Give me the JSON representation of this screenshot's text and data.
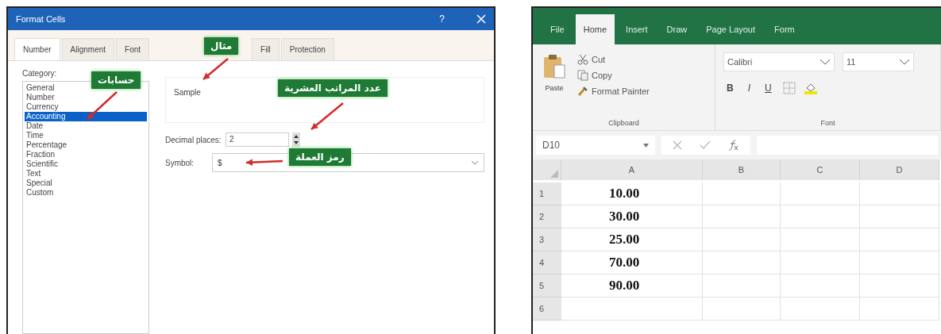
{
  "dialog": {
    "title": "Format Cells",
    "help": "?",
    "tabs": [
      {
        "label": "Number",
        "selected": true
      },
      {
        "label": "Alignment",
        "selected": false
      },
      {
        "label": "Font",
        "selected": false
      },
      {
        "label": "Fill",
        "selected": false
      },
      {
        "label": "Protection",
        "selected": false
      }
    ],
    "category_label": "Category:",
    "categories": [
      {
        "label": "General",
        "selected": false
      },
      {
        "label": "Number",
        "selected": false
      },
      {
        "label": "Currency",
        "selected": false
      },
      {
        "label": "Accounting",
        "selected": true
      },
      {
        "label": "Date",
        "selected": false
      },
      {
        "label": "Time",
        "selected": false
      },
      {
        "label": "Percentage",
        "selected": false
      },
      {
        "label": "Fraction",
        "selected": false
      },
      {
        "label": "Scientific",
        "selected": false
      },
      {
        "label": "Text",
        "selected": false
      },
      {
        "label": "Special",
        "selected": false
      },
      {
        "label": "Custom",
        "selected": false
      }
    ],
    "sample_label": "Sample",
    "decimal_places_label": "Decimal places:",
    "decimal_places_value": "2",
    "symbol_label": "Symbol:",
    "symbol_value": "$"
  },
  "callouts": [
    {
      "text": "مثال"
    },
    {
      "text": "حسابات"
    },
    {
      "text": "عدد المراتب العشرية"
    },
    {
      "text": "رمز العملة"
    }
  ],
  "excel": {
    "tabs": [
      {
        "label": "File",
        "selected": false
      },
      {
        "label": "Home",
        "selected": true
      },
      {
        "label": "Insert",
        "selected": false
      },
      {
        "label": "Draw",
        "selected": false
      },
      {
        "label": "Page Layout",
        "selected": false
      },
      {
        "label": "Form",
        "selected": false
      }
    ],
    "paste": "Paste",
    "cut": "Cut",
    "copy": "Copy",
    "format_painter": "Format Painter",
    "clipboard_label": "Clipboard",
    "font_name": "Calibri",
    "font_size": "11",
    "bold": "B",
    "italic": "I",
    "underline": "U",
    "font_label": "Font",
    "name_box": "D10",
    "columns": [
      "A",
      "B",
      "C",
      "D"
    ],
    "rows": [
      {
        "number": "1",
        "value": "10.00"
      },
      {
        "number": "2",
        "value": "30.00"
      },
      {
        "number": "3",
        "value": "25.00"
      },
      {
        "number": "4",
        "value": "70.00"
      },
      {
        "number": "5",
        "value": "90.00"
      },
      {
        "number": "6"
      }
    ]
  }
}
